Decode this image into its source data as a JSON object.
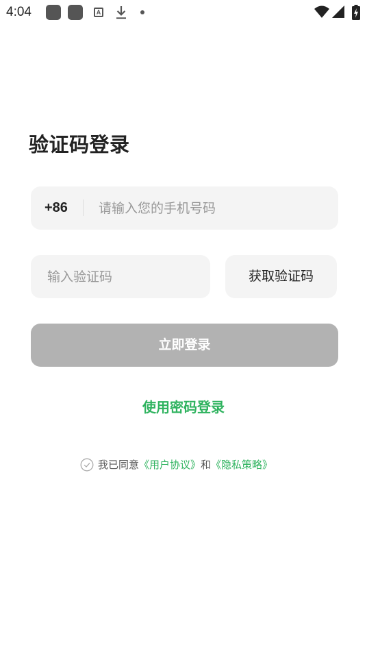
{
  "status_bar": {
    "time": "4:04",
    "notification_icons": [
      "app-notification-icon",
      "app-notification-icon",
      "a-notification-icon",
      "download-icon",
      "dot-icon"
    ],
    "system_icons": [
      "wifi-icon",
      "signal-icon",
      "battery-charging-icon"
    ]
  },
  "login": {
    "title": "验证码登录",
    "phone": {
      "country_code": "+86",
      "placeholder": "请输入您的手机号码"
    },
    "code": {
      "placeholder": "输入验证码",
      "get_code_label": "获取验证码"
    },
    "submit_label": "立即登录",
    "password_login_label": "使用密码登录",
    "agreement": {
      "prefix": "我已同意",
      "user_agreement": "《用户协议》",
      "conjunction": "和",
      "privacy_policy": "《隐私策略》",
      "checked": false
    }
  },
  "colors": {
    "accent": "#2fb35f",
    "field_background": "#f4f4f4",
    "button_disabled": "#b2b2b2",
    "text_primary": "#222222",
    "placeholder": "#999999"
  }
}
